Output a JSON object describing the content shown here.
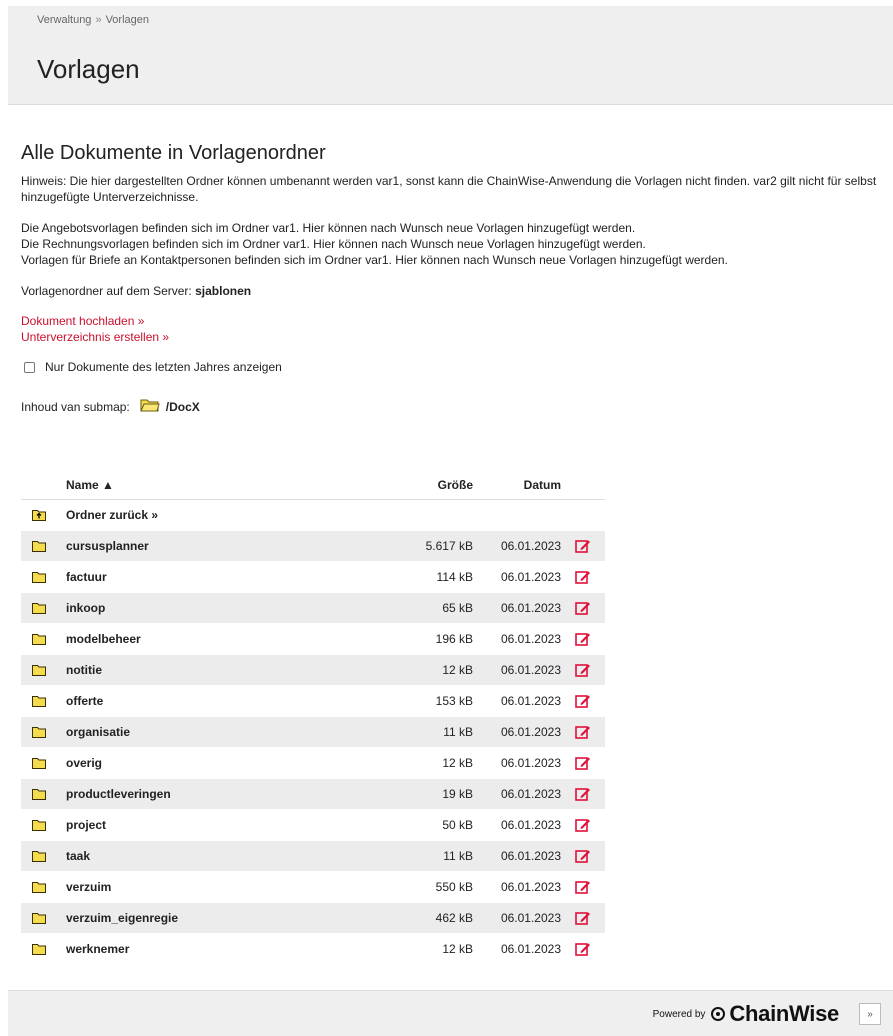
{
  "breadcrumb": {
    "items": [
      "Verwaltung",
      "Vorlagen"
    ],
    "separator": "»"
  },
  "page": {
    "title": "Vorlagen"
  },
  "section": {
    "title": "Alle Dokumente in Vorlagenordner",
    "note": "Hinweis: Die hier dargestellten Ordner können umbenannt werden var1, sonst kann die ChainWise-Anwendung die Vorlagen nicht finden. var2 gilt nicht für selbst hinzugefügte Unterverzeichnisse.",
    "paragraphs": [
      "Die Angebotsvorlagen befinden sich im Ordner var1. Hier können nach Wunsch neue Vorlagen hinzugefügt werden.",
      "Die Rechnungsvorlagen befinden sich im Ordner var1. Hier können nach Wunsch neue Vorlagen hinzugefügt werden.",
      "Vorlagen für Briefe an Kontaktpersonen befinden sich im Ordner var1. Hier können nach Wunsch neue Vorlagen hinzugefügt werden."
    ],
    "server_label": "Vorlagenordner auf dem Server:",
    "server_value": "sjablonen"
  },
  "links": {
    "upload": "Dokument hochladen »",
    "create_dir": "Unterverzeichnis erstellen »"
  },
  "filter": {
    "label": "Nur Dokumente des letzten Jahres anzeigen",
    "checked": false
  },
  "submap": {
    "label": "Inhoud van submap:",
    "path": "/DocX"
  },
  "table": {
    "headers": {
      "name": "Name ▲",
      "size": "Größe",
      "date": "Datum"
    },
    "back_label": "Ordner zurück »",
    "rows": [
      {
        "name": "cursusplanner",
        "size": "5.617 kB",
        "date": "06.01.2023"
      },
      {
        "name": "factuur",
        "size": "114 kB",
        "date": "06.01.2023"
      },
      {
        "name": "inkoop",
        "size": "65 kB",
        "date": "06.01.2023"
      },
      {
        "name": "modelbeheer",
        "size": "196 kB",
        "date": "06.01.2023"
      },
      {
        "name": "notitie",
        "size": "12 kB",
        "date": "06.01.2023"
      },
      {
        "name": "offerte",
        "size": "153 kB",
        "date": "06.01.2023"
      },
      {
        "name": "organisatie",
        "size": "11 kB",
        "date": "06.01.2023"
      },
      {
        "name": "overig",
        "size": "12 kB",
        "date": "06.01.2023"
      },
      {
        "name": "productleveringen",
        "size": "19 kB",
        "date": "06.01.2023"
      },
      {
        "name": "project",
        "size": "50 kB",
        "date": "06.01.2023"
      },
      {
        "name": "taak",
        "size": "11 kB",
        "date": "06.01.2023"
      },
      {
        "name": "verzuim",
        "size": "550 kB",
        "date": "06.01.2023"
      },
      {
        "name": "verzuim_eigenregie",
        "size": "462 kB",
        "date": "06.01.2023"
      },
      {
        "name": "werknemer",
        "size": "12 kB",
        "date": "06.01.2023"
      }
    ]
  },
  "footer": {
    "powered_by": "Powered by",
    "brand": "ChainWise",
    "scroll_symbol": "»"
  },
  "colors": {
    "link": "#c8102e",
    "folder": "#f5dc4e",
    "edit_icon": "#e0103a",
    "band": "#efefef"
  }
}
